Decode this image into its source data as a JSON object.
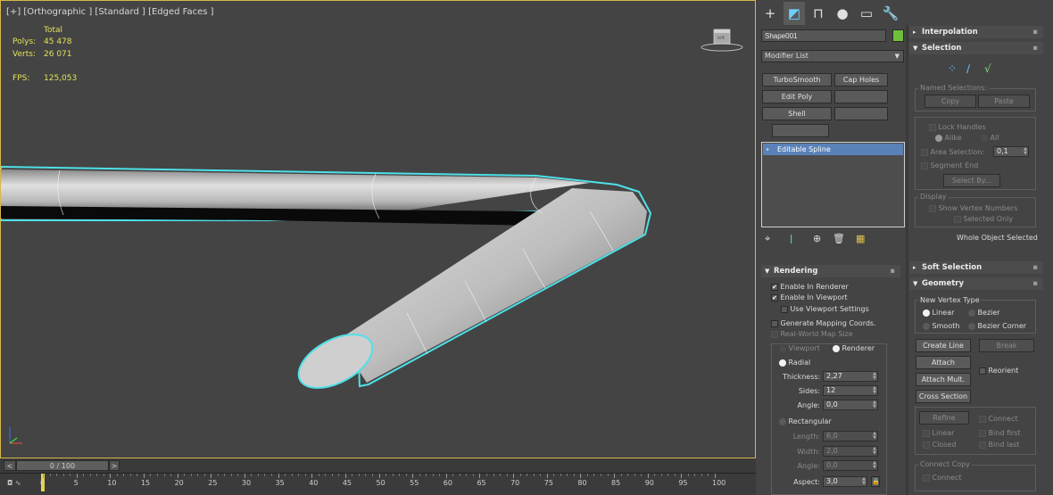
{
  "viewport": {
    "label": "[+] [Orthographic ] [Standard ] [Edged Faces ]",
    "stats": {
      "total_label": "Total",
      "polys_label": "Polys:",
      "polys_value": "45 478",
      "verts_label": "Verts:",
      "verts_value": "26 071",
      "fps_label": "FPS:",
      "fps_value": "125,053"
    }
  },
  "timeline": {
    "slider_label": "0 / 100",
    "prev": "<",
    "next": ">",
    "ticks": [
      "0",
      "5",
      "10",
      "15",
      "20",
      "25",
      "30",
      "35",
      "40",
      "45",
      "50",
      "55",
      "60",
      "65",
      "70",
      "75",
      "80",
      "85",
      "90",
      "95",
      "100"
    ]
  },
  "command_panel": {
    "tabs": [
      {
        "icon": "plus-icon",
        "glyph": "+"
      },
      {
        "icon": "modify-icon",
        "glyph": "◩"
      },
      {
        "icon": "hierarchy-icon",
        "glyph": "⊓"
      },
      {
        "icon": "motion-icon",
        "glyph": "●"
      },
      {
        "icon": "display-icon",
        "glyph": "▭"
      },
      {
        "icon": "utilities-icon",
        "glyph": "🔧"
      }
    ],
    "object_name": "Shape001",
    "object_color": "#6fbf3a",
    "modifier_list": "Modifier List",
    "modifier_buttons": [
      "TurboSmooth",
      "Cap Holes",
      "Edit Poly",
      "",
      "Shell",
      "",
      ""
    ],
    "stack_item": "Editable Spline",
    "stack_icons": [
      "pin-icon",
      "show-end-result-icon",
      "make-unique-icon",
      "remove-modifier-icon",
      "configure-modifier-sets-icon"
    ]
  },
  "rendering": {
    "title": "Rendering",
    "enable_in_renderer": "Enable In Renderer",
    "enable_in_viewport": "Enable In Viewport",
    "use_viewport_settings": "Use Viewport Settings",
    "generate_mapping": "Generate Mapping Coords.",
    "real_world": "Real-World Map Size",
    "viewport_opt": "Viewport",
    "renderer_opt": "Renderer",
    "radial": "Radial",
    "thickness_label": "Thickness:",
    "thickness": "2,27",
    "sides_label": "Sides:",
    "sides": "12",
    "angle_label": "Angle:",
    "angle": "0,0",
    "rectangular": "Rectangular",
    "length_label": "Length:",
    "length": "6,0",
    "width_label": "Width:",
    "width": "2,0",
    "angle2_label": "Angle:",
    "angle2": "0,0",
    "aspect_label": "Aspect:",
    "aspect": "3,0"
  },
  "interpolation": {
    "title": "Interpolation"
  },
  "selection": {
    "title": "Selection",
    "named_selections": "Named Selections:",
    "copy": "Copy",
    "paste": "Paste",
    "lock_handles": "Lock Handles",
    "alike": "Alike",
    "all": "All",
    "area_selection": "Area Selection:",
    "area_value": "0,1",
    "segment_end": "Segment End",
    "select_by": "Select By...",
    "display": "Display",
    "show_vertex_numbers": "Show Vertex Numbers",
    "selected_only": "Selected Only",
    "status": "Whole Object Selected"
  },
  "soft_selection": {
    "title": "Soft Selection"
  },
  "geometry": {
    "title": "Geometry",
    "new_vertex_type": "New Vertex Type",
    "linear": "Linear",
    "bezier": "Bezier",
    "smooth": "Smooth",
    "bezier_corner": "Bezier Corner",
    "create_line": "Create Line",
    "break": "Break",
    "attach": "Attach",
    "reorient": "Reorient",
    "attach_mult": "Attach Mult.",
    "cross_section": "Cross Section",
    "refine": "Refine",
    "connect": "Connect",
    "linear2": "Linear",
    "bind_first": "Bind first",
    "closed": "Closed",
    "bind_last": "Bind last",
    "connect_copy": "Connect Copy",
    "connect2": "Connect"
  }
}
